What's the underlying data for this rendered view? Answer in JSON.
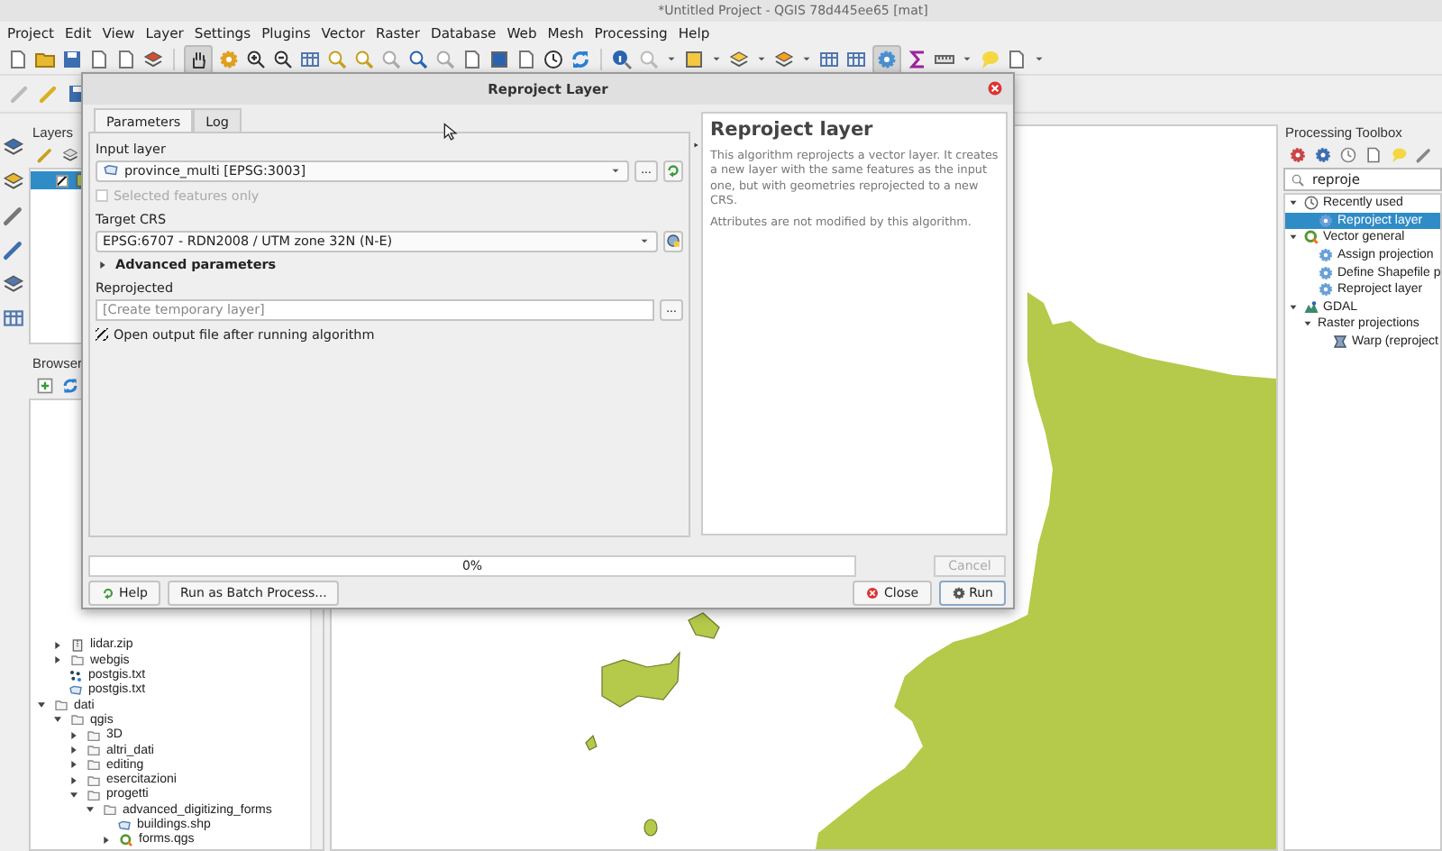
{
  "window": {
    "title": "*Untitled Project - QGIS 78d445ee65 [mat]"
  },
  "menu": [
    "Project",
    "Edit",
    "View",
    "Layer",
    "Settings",
    "Plugins",
    "Vector",
    "Raster",
    "Database",
    "Web",
    "Mesh",
    "Processing",
    "Help"
  ],
  "layers_panel": {
    "title": "Layers",
    "layers": [
      {
        "checked": true,
        "selected": true
      }
    ]
  },
  "browser_panel": {
    "title": "Browser",
    "tree_tail": [
      {
        "label": "lidar.zip",
        "kind": "zip",
        "expanded": false
      },
      {
        "label": "webgis",
        "kind": "folder",
        "expanded": false
      },
      {
        "label": "postgis.txt",
        "kind": "points"
      },
      {
        "label": "postgis.txt",
        "kind": "polygon"
      }
    ],
    "tree": [
      {
        "label": "dati",
        "kind": "folder",
        "expanded": true,
        "children": [
          {
            "label": "qgis",
            "kind": "folder",
            "expanded": true,
            "children": [
              {
                "label": "3D",
                "kind": "folder",
                "expanded": false
              },
              {
                "label": "altri_dati",
                "kind": "folder",
                "expanded": false
              },
              {
                "label": "editing",
                "kind": "folder",
                "expanded": false
              },
              {
                "label": "esercitazioni",
                "kind": "folder",
                "expanded": false
              },
              {
                "label": "progetti",
                "kind": "folder",
                "expanded": true,
                "children": [
                  {
                    "label": "advanced_digitizing_forms",
                    "kind": "folder",
                    "expanded": true,
                    "children": [
                      {
                        "label": "buildings.shp",
                        "kind": "polygon"
                      },
                      {
                        "label": "forms.qgs",
                        "kind": "project",
                        "expanded": false
                      }
                    ]
                  }
                ]
              }
            ]
          }
        ]
      }
    ]
  },
  "toolbox": {
    "title": "Processing Toolbox",
    "search": "reproje",
    "tree": [
      {
        "label": "Recently used",
        "kind": "recent",
        "expanded": true,
        "selected": false,
        "children": [
          {
            "label": "Reproject layer",
            "kind": "algorithm",
            "selected": true
          }
        ]
      },
      {
        "label": "Vector general",
        "kind": "qgis",
        "expanded": true,
        "selected": false,
        "children": [
          {
            "label": "Assign projection",
            "kind": "algorithm",
            "selected": false
          },
          {
            "label": "Define Shapefile p",
            "kind": "algorithm",
            "selected": false
          },
          {
            "label": "Reproject layer",
            "kind": "algorithm",
            "selected": false
          }
        ]
      },
      {
        "label": "GDAL",
        "kind": "gdal",
        "expanded": true,
        "selected": false,
        "children": [
          {
            "label": "Raster projections",
            "kind": "group",
            "expanded": true,
            "selected": false,
            "children": [
              {
                "label": "Warp (reproject",
                "kind": "raster",
                "selected": false
              }
            ]
          }
        ]
      }
    ]
  },
  "dialog": {
    "title": "Reproject Layer",
    "tabs": [
      {
        "label": "Parameters",
        "selected": true
      },
      {
        "label": "Log",
        "selected": false
      }
    ],
    "input_layer": {
      "label": "Input layer",
      "value": "province_multi [EPSG:3003]",
      "browse": "..."
    },
    "selected_only": {
      "label": "Selected features only",
      "checked": false,
      "disabled": true
    },
    "target_crs": {
      "label": "Target CRS",
      "value": "EPSG:6707 - RDN2008 / UTM zone 32N (N-E)"
    },
    "advanced": {
      "label": "Advanced parameters",
      "expanded": false
    },
    "output": {
      "label": "Reprojected",
      "placeholder": "[Create temporary layer]",
      "browse": "..."
    },
    "open_output": {
      "label": "Open output file after running algorithm",
      "checked": true
    },
    "help": {
      "title": "Reproject layer",
      "paragraphs": [
        "This algorithm reprojects a vector layer. It creates a new layer with the same features as the input one, but with geometries reprojected to a new CRS.",
        "Attributes are not modified by this algorithm."
      ]
    },
    "progress": {
      "level": 0,
      "text": "0%"
    },
    "cancel": {
      "label": "Cancel",
      "disabled": true
    },
    "buttons": [
      {
        "label": "Help",
        "kind": "help"
      },
      {
        "label": "Run as Batch Process...",
        "kind": "batch"
      },
      {
        "label": "Close",
        "kind": "close"
      },
      {
        "label": "Run",
        "kind": "run"
      }
    ]
  }
}
